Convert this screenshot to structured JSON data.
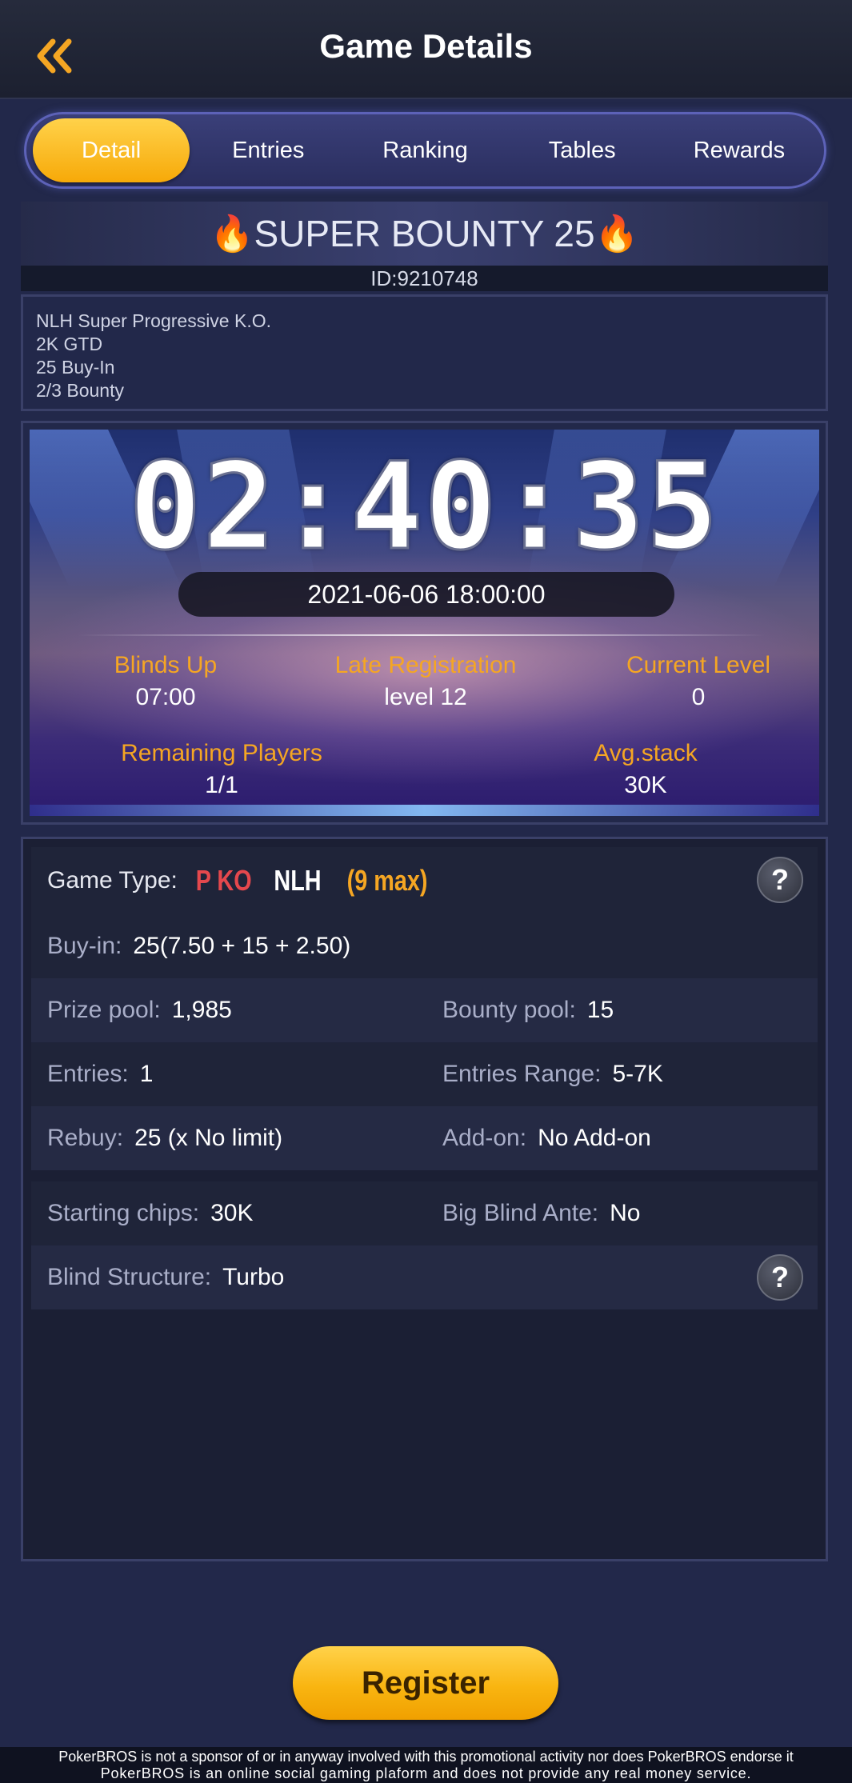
{
  "header": {
    "title": "Game Details"
  },
  "tabs": [
    "Detail",
    "Entries",
    "Ranking",
    "Tables",
    "Rewards"
  ],
  "active_tab": "Detail",
  "tournament": {
    "name": "SUPER BOUNTY 25",
    "id": "ID:9210748",
    "description": [
      "NLH Super Progressive K.O.",
      "2K GTD",
      "25 Buy-In",
      "2/3 Bounty"
    ]
  },
  "banner": {
    "countdown": "02:40:35",
    "start_time": "2021-06-06 18:00:00",
    "stats": {
      "blinds_up": {
        "label": "Blinds Up",
        "value": "07:00"
      },
      "late_registration": {
        "label": "Late Registration",
        "value": "level 12"
      },
      "current_level": {
        "label": "Current Level",
        "value": "0"
      },
      "remaining_players": {
        "label": "Remaining Players",
        "value": "1/1"
      },
      "avg_stack": {
        "label": "Avg.stack",
        "value": "30K"
      }
    }
  },
  "details": {
    "game_type": {
      "label": "Game Type:",
      "p": "P KO",
      "nlh": "NLH",
      "max": "(9 max)"
    },
    "buy_in": {
      "label": "Buy-in:",
      "value": "25(7.50 + 15 + 2.50)"
    },
    "prize_pool": {
      "label": "Prize pool:",
      "value": "1,985"
    },
    "bounty_pool": {
      "label": "Bounty pool:",
      "value": "15"
    },
    "entries": {
      "label": "Entries:",
      "value": "1"
    },
    "entries_range": {
      "label": "Entries Range:",
      "value": "5-7K"
    },
    "rebuy": {
      "label": "Rebuy:",
      "value": "25 (x No limit)"
    },
    "add_on": {
      "label": "Add-on:",
      "value": "No Add-on"
    },
    "starting_chips": {
      "label": "Starting chips:",
      "value": "30K"
    },
    "big_blind_ante": {
      "label": "Big Blind Ante:",
      "value": "No"
    },
    "blind_structure": {
      "label": "Blind Structure:",
      "value": "Turbo"
    },
    "help_glyph": "?"
  },
  "register_label": "Register",
  "disclaimer": [
    "PokerBROS is not a sponsor of or in anyway involved with this promotional activity nor does PokerBROS endorse it",
    "PokerBROS is an online social gaming plaform and does not provide any real money service."
  ],
  "colors": {
    "accent": "#f5a623",
    "ko_red": "#e5484d",
    "background": "#22284a"
  },
  "icons": {
    "back": "double-chevron-left-icon",
    "flame": "🔥",
    "help": "help-icon"
  }
}
